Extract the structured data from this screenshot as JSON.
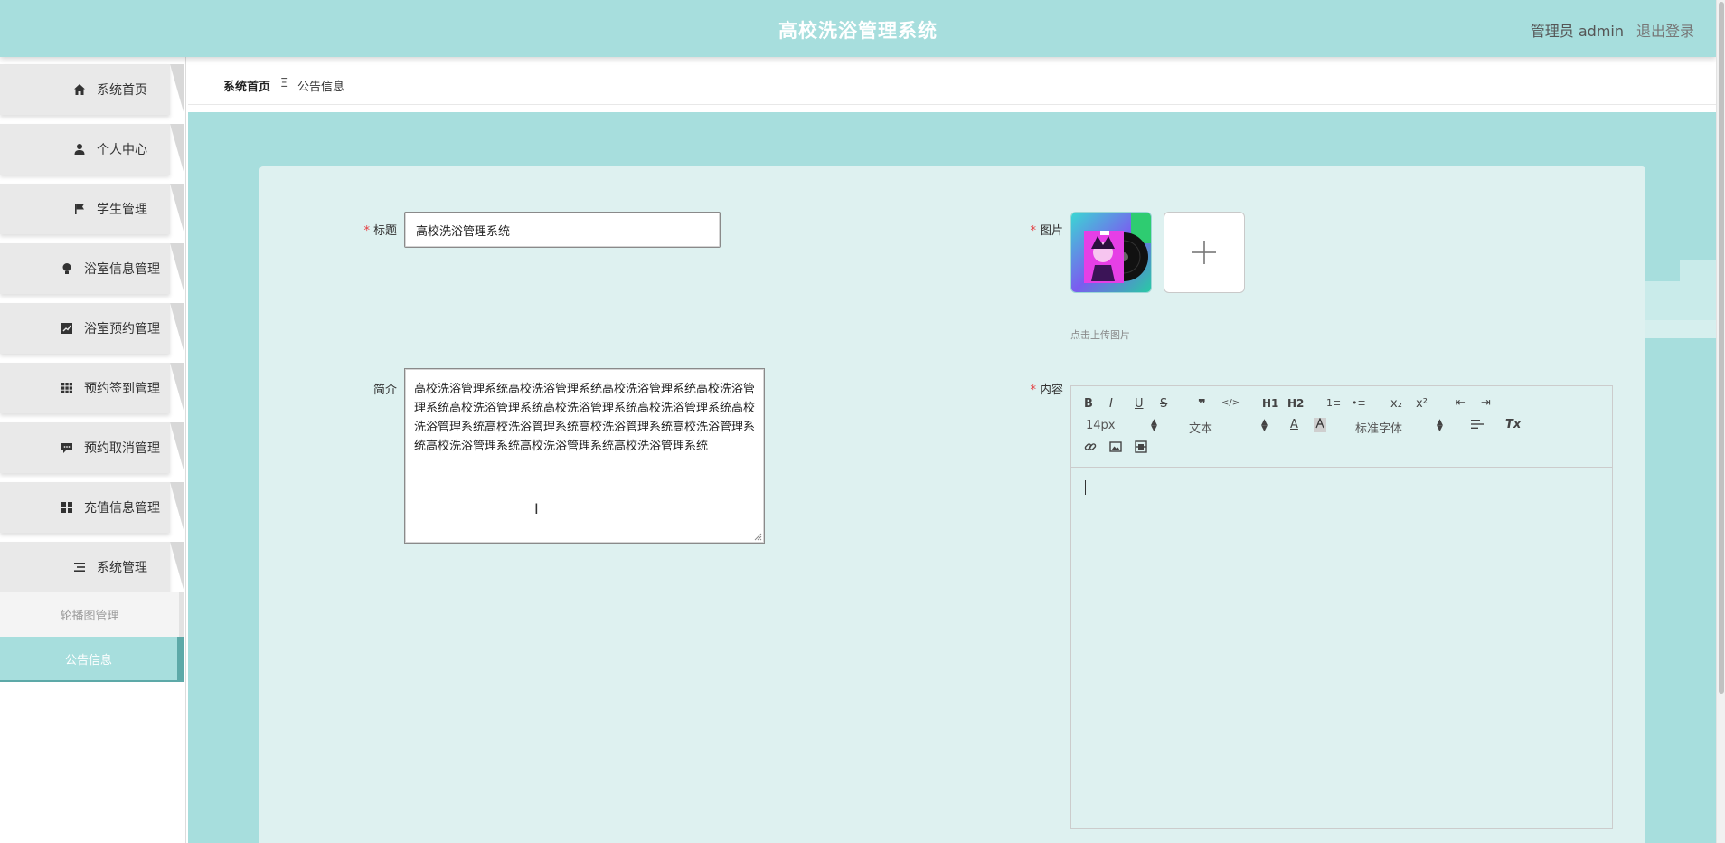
{
  "header": {
    "title": "高校洗浴管理系统",
    "user_label": "管理员 admin",
    "logout_label": "退出登录"
  },
  "sidebar": {
    "items": [
      {
        "label": "系统首页",
        "icon": "home-icon"
      },
      {
        "label": "个人中心",
        "icon": "user-icon"
      },
      {
        "label": "学生管理",
        "icon": "flag-icon"
      },
      {
        "label": "浴室信息管理",
        "icon": "lightbulb-icon"
      },
      {
        "label": "浴室预约管理",
        "icon": "chart-icon"
      },
      {
        "label": "预约签到管理",
        "icon": "grid-icon"
      },
      {
        "label": "预约取消管理",
        "icon": "comment-icon"
      },
      {
        "label": "充值信息管理",
        "icon": "apps-icon"
      },
      {
        "label": "系统管理",
        "icon": "list-icon"
      }
    ],
    "submenu": [
      {
        "label": "轮播图管理"
      },
      {
        "label": "公告信息",
        "active": true
      }
    ]
  },
  "breadcrumb": {
    "home": "系统首页",
    "separator": "Ξ",
    "current": "公告信息"
  },
  "form": {
    "title_label": "标题",
    "title_value": "高校洗浴管理系统",
    "image_label": "图片",
    "upload_hint": "点击上传图片",
    "intro_label": "简介",
    "intro_value": "高校洗浴管理系统高校洗浴管理系统高校洗浴管理系统高校洗浴管理系统高校洗浴管理系统高校洗浴管理系统高校洗浴管理系统高校洗浴管理系统高校洗浴管理系统高校洗浴管理系统高校洗浴管理系统高校洗浴管理系统高校洗浴管理系统高校洗浴管理系统",
    "content_label": "内容",
    "required_mark": "*"
  },
  "editor": {
    "buttons": [
      "B",
      "I",
      "U",
      "S",
      "❞",
      "</>",
      "H1",
      "H2",
      "1≡",
      "•≡",
      "x₂",
      "x²",
      "⇤",
      "⇥"
    ],
    "size_value": "14px",
    "style_value": "文本",
    "font_value": "标准字体",
    "text_color_glyph": "A",
    "clear_glyph": "Tx"
  },
  "colors": {
    "accent": "#a7dedd",
    "accent_dark": "#5da9a8",
    "card": "#def1f0",
    "required": "#e4393c"
  }
}
